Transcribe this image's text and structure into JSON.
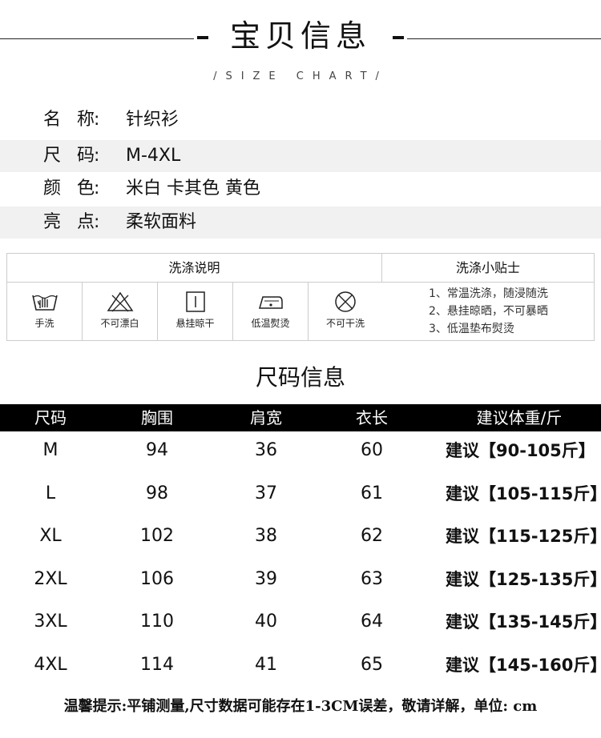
{
  "header": {
    "title": "宝贝信息",
    "subtitle": "/SIZE CHART/"
  },
  "info": [
    {
      "label": "名称",
      "colon": ":",
      "value": "针织衫"
    },
    {
      "label": "尺码",
      "colon": ":",
      "value": "M-4XL"
    },
    {
      "label": "颜色",
      "colon": ":",
      "value": "米白 卡其色 黄色"
    },
    {
      "label": "亮点",
      "colon": ":",
      "value": "柔软面料"
    }
  ],
  "wash": {
    "heading_left": "洗涤说明",
    "heading_right": "洗涤小贴士",
    "symbols": [
      {
        "icon": "hand-wash-icon",
        "label": "手洗"
      },
      {
        "icon": "no-bleach-icon",
        "label": "不可漂白"
      },
      {
        "icon": "hang-dry-icon",
        "label": "悬挂晾干"
      },
      {
        "icon": "low-iron-icon",
        "label": "低温熨烫"
      },
      {
        "icon": "no-dry-clean-icon",
        "label": "不可干洗"
      }
    ],
    "tips": [
      "1、常温洗涤，随浸随洗",
      "2、悬挂晾晒，不可暴晒",
      "3、低温垫布熨烫"
    ]
  },
  "size_chart": {
    "title": "尺码信息",
    "headers": [
      "尺码",
      "胸围",
      "肩宽",
      "衣长",
      "建议体重/斤"
    ],
    "rows": [
      [
        "M",
        "94",
        "36",
        "60",
        "建议【90-105斤】"
      ],
      [
        "L",
        "98",
        "37",
        "61",
        "建议【105-115斤】"
      ],
      [
        "XL",
        "102",
        "38",
        "62",
        "建议【115-125斤】"
      ],
      [
        "2XL",
        "106",
        "39",
        "63",
        "建议【125-135斤】"
      ],
      [
        "3XL",
        "110",
        "40",
        "64",
        "建议【135-145斤】"
      ],
      [
        "4XL",
        "114",
        "41",
        "65",
        "建议【145-160斤】"
      ]
    ]
  },
  "footer_note": "温馨提示:平铺测量,尺寸数据可能存在1-3CM误差，敬请详解，单位: cm"
}
